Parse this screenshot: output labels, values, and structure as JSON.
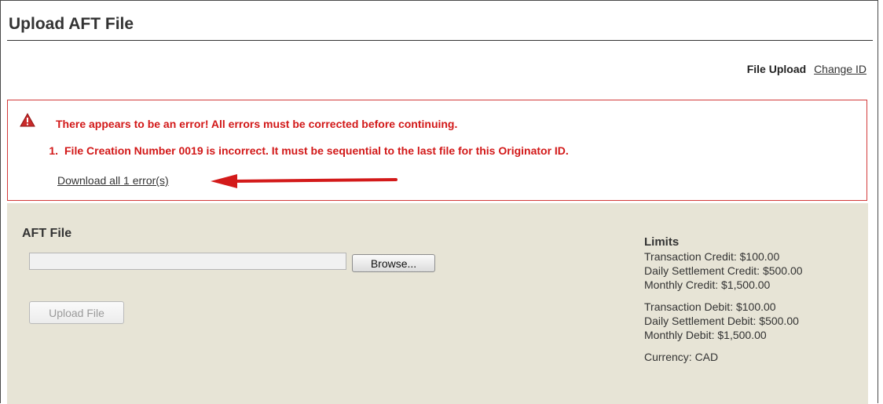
{
  "page": {
    "title": "Upload AFT File"
  },
  "nav": {
    "current": "File Upload",
    "change_id": "Change ID"
  },
  "error": {
    "headline": "There appears to be an error! All errors must be corrected before continuing.",
    "items": [
      {
        "num": "1.",
        "text": "File Creation Number 0019 is incorrect. It must be sequential to the last file for this Originator ID."
      }
    ],
    "download_label": "Download all 1 error(s)",
    "icon": "warning-triangle-icon",
    "color": "#d21818"
  },
  "aft": {
    "title": "AFT File",
    "file_value": "",
    "browse_label": "Browse...",
    "upload_label": "Upload File"
  },
  "limits": {
    "title": "Limits",
    "credit": [
      "Transaction Credit: $100.00",
      "Daily Settlement Credit: $500.00",
      "Monthly Credit: $1,500.00"
    ],
    "debit": [
      "Transaction Debit: $100.00",
      "Daily Settlement Debit: $500.00",
      "Monthly Debit: $1,500.00"
    ],
    "currency": "Currency: CAD"
  },
  "colors": {
    "panel_bg": "#e7e4d6",
    "error_border": "#d23a3a",
    "arrow": "#d31a1a"
  }
}
